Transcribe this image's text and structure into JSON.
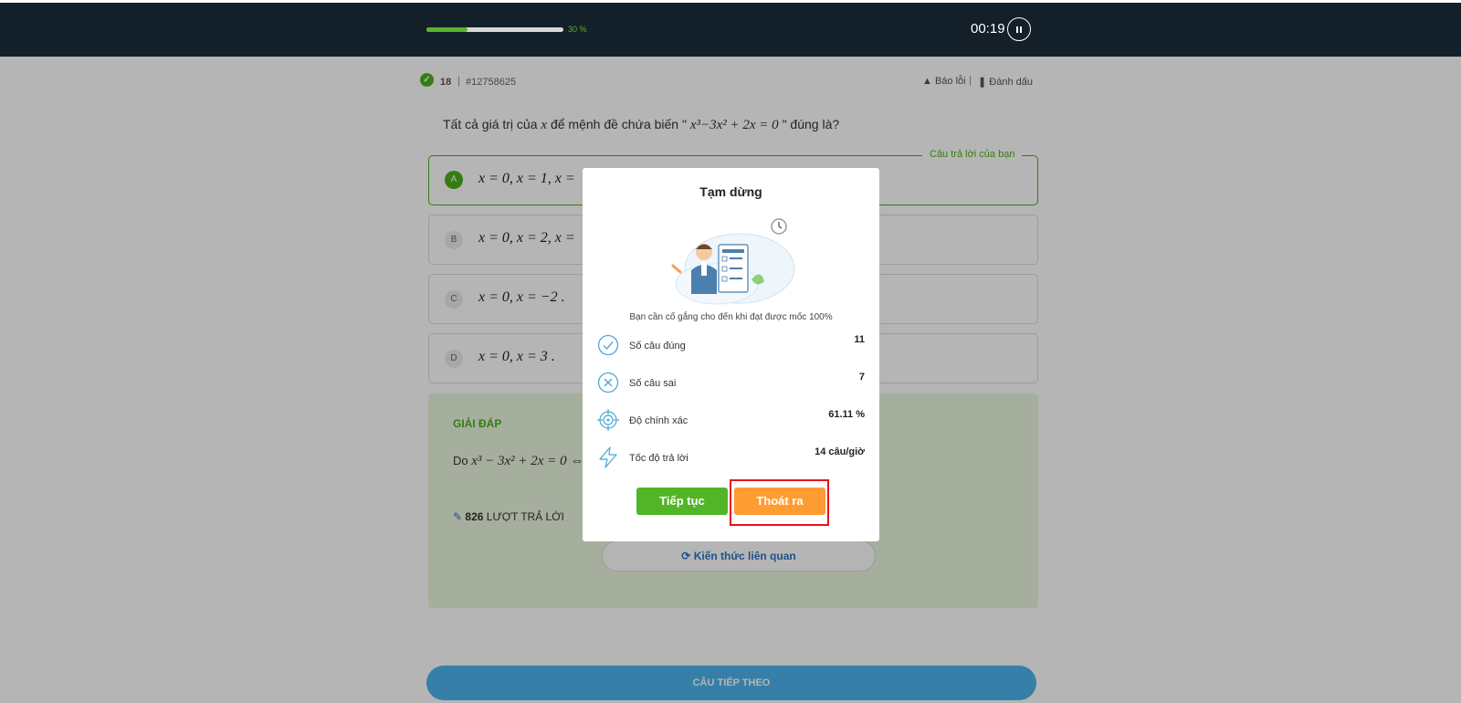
{
  "header": {
    "progress_value": 30,
    "progress_label": "30 %",
    "timer": "00:19"
  },
  "question": {
    "correct_count": "18",
    "separator": "|",
    "id": "#12758625",
    "report_label": "Báo lỗi",
    "bookmark_label": "Đánh dấu",
    "text_prefix": "Tất cả giá trị của ",
    "text_var": "x",
    "text_mid": " để mệnh đề chứa biến \" ",
    "text_math": "x³−3x² + 2x = 0",
    "text_suffix": " \" đúng là?",
    "your_answer_label": "Câu trả lời của bạn"
  },
  "options": [
    {
      "letter": "A",
      "text": "x = 0, x = 1, x ="
    },
    {
      "letter": "B",
      "text": "x = 0, x = 2, x ="
    },
    {
      "letter": "C",
      "text": "x = 0, x = −2 ."
    },
    {
      "letter": "D",
      "text": "x = 0, x = 3 ."
    }
  ],
  "solution": {
    "title": "GIẢI ĐÁP",
    "text_prefix": "Do ",
    "text_math": "x³ − 3x² + 2x = 0 ⇔",
    "answers_count": "826",
    "answers_label": " LƯỢT TRẢ LỜI",
    "related_label": "Kiến thức liên quan"
  },
  "next_button_label": "CÂU TIẾP THEO",
  "modal": {
    "title": "Tạm dừng",
    "message": "Bạn cần cố gắng cho đến khi đạt được mốc 100%",
    "stats": [
      {
        "label": "Số câu đúng",
        "value": "11",
        "icon": "check-circle-icon"
      },
      {
        "label": "Số câu sai",
        "value": "7",
        "icon": "x-circle-icon"
      },
      {
        "label": "Độ chính xác",
        "value": "61.11 %",
        "icon": "target-icon"
      },
      {
        "label": "Tốc độ trả lời",
        "value": "14 câu/giờ",
        "icon": "lightning-icon"
      }
    ],
    "continue_label": "Tiếp tục",
    "exit_label": "Thoát ra"
  },
  "colors": {
    "header_bg": "#13202a",
    "accent_green": "#4caf1e",
    "exit_orange": "#ff9b33",
    "highlight_red": "#e8101a",
    "link_blue": "#2b72c4"
  }
}
